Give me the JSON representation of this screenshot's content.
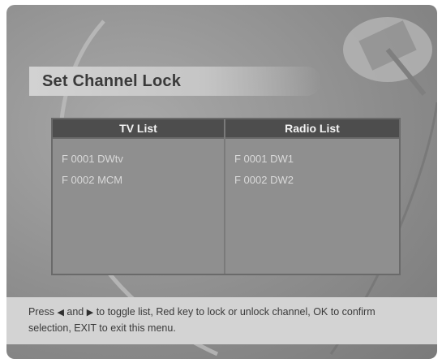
{
  "title": "Set Channel Lock",
  "tv_list": {
    "header": "TV List",
    "channels": [
      "F 0001 DWtv",
      "F 0002 MCM"
    ]
  },
  "radio_list": {
    "header": "Radio List",
    "channels": [
      "F 0001 DW1",
      "F 0002 DW2"
    ]
  },
  "help": {
    "part1": "Press",
    "left_arrow": "◀",
    "part2": "and",
    "right_arrow": "▶",
    "part3": "to toggle list, Red key to lock or unlock channel, OK to confirm selection, EXIT to exit this menu."
  },
  "colors": {
    "background": "#8e8e8e",
    "title_bar": "#c5c5c5",
    "list_header": "#4d4d4d",
    "help_band": "#d3d3d3"
  }
}
